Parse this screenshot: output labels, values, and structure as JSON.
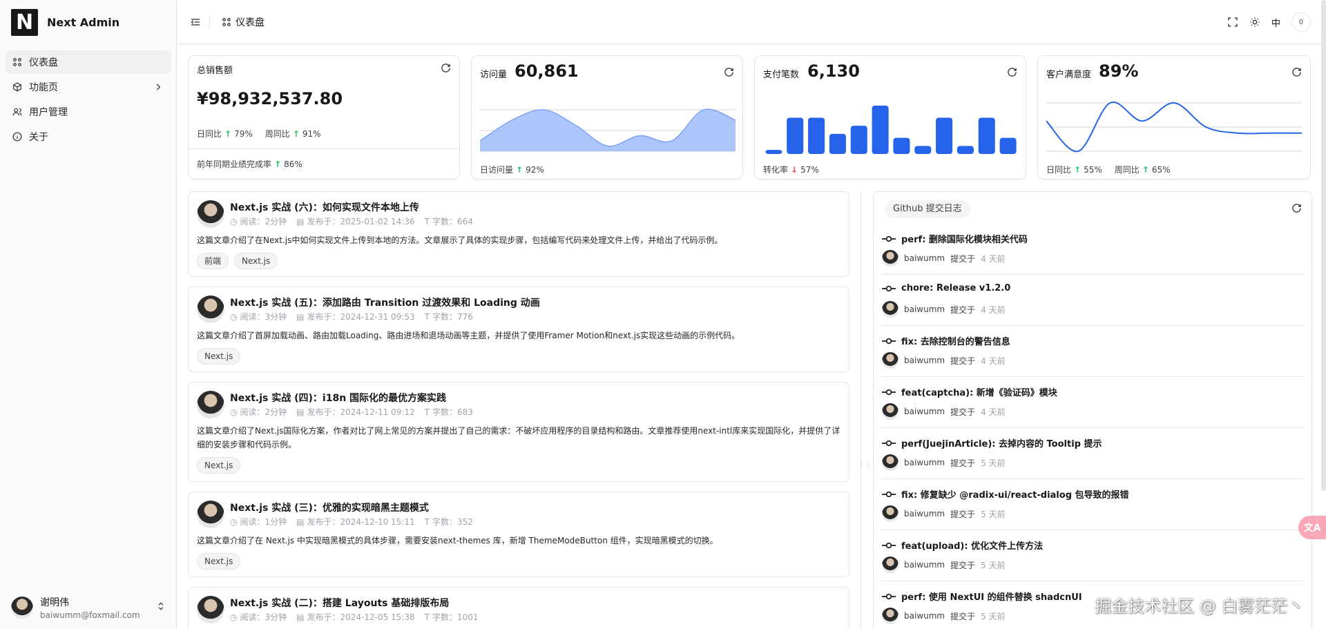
{
  "brand": {
    "logo_letter": "N",
    "name": "Next Admin"
  },
  "nav": [
    {
      "label": "仪表盘",
      "icon": "dashboard-icon",
      "active": true
    },
    {
      "label": "功能页",
      "icon": "package-icon",
      "has_children": true
    },
    {
      "label": "用户管理",
      "icon": "users-icon"
    },
    {
      "label": "关于",
      "icon": "info-icon"
    }
  ],
  "user": {
    "name": "谢明伟",
    "email": "baiwumm@foxmail.com"
  },
  "header": {
    "breadcrumb": "仪表盘",
    "lang": "中",
    "badge": "0"
  },
  "cards": {
    "sales": {
      "title": "总销售额",
      "value": "¥98,932,537.80",
      "day_label": "日同比",
      "day_value": "79%",
      "week_label": "周同比",
      "week_value": "91%",
      "footer_label": "前年同期业绩完成率",
      "footer_value": "86%"
    },
    "visits": {
      "title": "访问量",
      "value": "60,861",
      "footer_label": "日访问量",
      "footer_value": "92%"
    },
    "payments": {
      "title": "支付笔数",
      "value": "6,130",
      "footer_label": "转化率",
      "footer_value": "57%"
    },
    "satisfaction": {
      "title": "客户满意度",
      "value": "89%",
      "day_label": "日同比",
      "day_value": "55%",
      "week_label": "周同比",
      "week_value": "65%"
    }
  },
  "chart_data": [
    {
      "type": "area",
      "values": [
        2,
        6,
        8,
        5,
        1,
        3,
        2,
        8,
        6
      ],
      "color": "#a3bffa"
    },
    {
      "type": "bar",
      "values": [
        1,
        9,
        9,
        5,
        7,
        12,
        4,
        2,
        9,
        2,
        9,
        4
      ],
      "color": "#2563eb"
    },
    {
      "type": "line",
      "values": [
        5,
        0,
        8,
        5,
        8,
        4,
        3,
        3,
        3
      ],
      "color": "#2563eb"
    }
  ],
  "articles": [
    {
      "title": "Next.js 实战 (六)：如何实现文件本地上传",
      "read": "阅读：2分钟",
      "date": "发布于：2025-01-02 14:36",
      "words": "字数：664",
      "desc": "这篇文章介绍了在Next.js中如何实现文件上传到本地的方法。文章展示了具体的实现步骤，包括编写代码来处理文件上传，并给出了代码示例。",
      "tags": [
        "前端",
        "Next.js"
      ]
    },
    {
      "title": "Next.js 实战 (五)：添加路由 Transition 过渡效果和 Loading 动画",
      "read": "阅读：3分钟",
      "date": "发布于：2024-12-31 09:53",
      "words": "字数：776",
      "desc": "这篇文章介绍了首屏加载动画、路由加载Loading、路由进场和退场动画等主题，并提供了使用Framer Motion和next.js实现这些动画的示例代码。",
      "tags": [
        "Next.js"
      ]
    },
    {
      "title": "Next.js 实战 (四)：i18n 国际化的最优方案实践",
      "read": "阅读：2分钟",
      "date": "发布于：2024-12-11 09:12",
      "words": "字数：683",
      "desc": "这篇文章介绍了Next.js国际化方案，作者对比了网上常见的方案并提出了自己的需求：不破坏应用程序的目录结构和路由。文章推荐使用next-intl库来实现国际化，并提供了详细的安装步骤和代码示例。",
      "tags": [
        "Next.js"
      ]
    },
    {
      "title": "Next.js 实战 (三)：优雅的实现暗黑主题模式",
      "read": "阅读：1分钟",
      "date": "发布于：2024-12-10 15:11",
      "words": "字数：352",
      "desc": "这篇文章介绍了在 Next.js 中实现暗黑模式的具体步骤，需要安装next-themes 库，新增 ThemeModeButton 组件，实现暗黑模式的切换。",
      "tags": [
        "Next.js"
      ]
    },
    {
      "title": "Next.js 实战 (二)：搭建 Layouts 基础排版布局",
      "read": "阅读：3分钟",
      "date": "发布于：2024-12-05 15:38",
      "words": "字数：1001",
      "desc": "",
      "tags": []
    }
  ],
  "commits": {
    "title": "Github 提交日志",
    "author": "baiwumm",
    "committed_label": "提交于",
    "items": [
      {
        "message": "perf: 删除国际化模块相关代码",
        "time": "4 天前"
      },
      {
        "message": "chore: Release v1.2.0",
        "time": "4 天前"
      },
      {
        "message": "fix: 去除控制台的警告信息",
        "time": "4 天前"
      },
      {
        "message": "feat(captcha): 新增《验证码》模块",
        "time": "4 天前"
      },
      {
        "message": "perf(JuejinArticle): 去掉内容的 Tooltip 提示",
        "time": "5 天前"
      },
      {
        "message": "fix: 修复缺少 @radix-ui/react-dialog 包导致的报错",
        "time": "5 天前"
      },
      {
        "message": "feat(upload): 优化文件上传方法",
        "time": "5 天前"
      },
      {
        "message": "perf: 使用 NextUI 的组件替换 shadcnUI",
        "time": "5 天前"
      }
    ]
  },
  "watermark": "掘金技术社区 @ 白雾茫茫丶",
  "float_button": "文A"
}
